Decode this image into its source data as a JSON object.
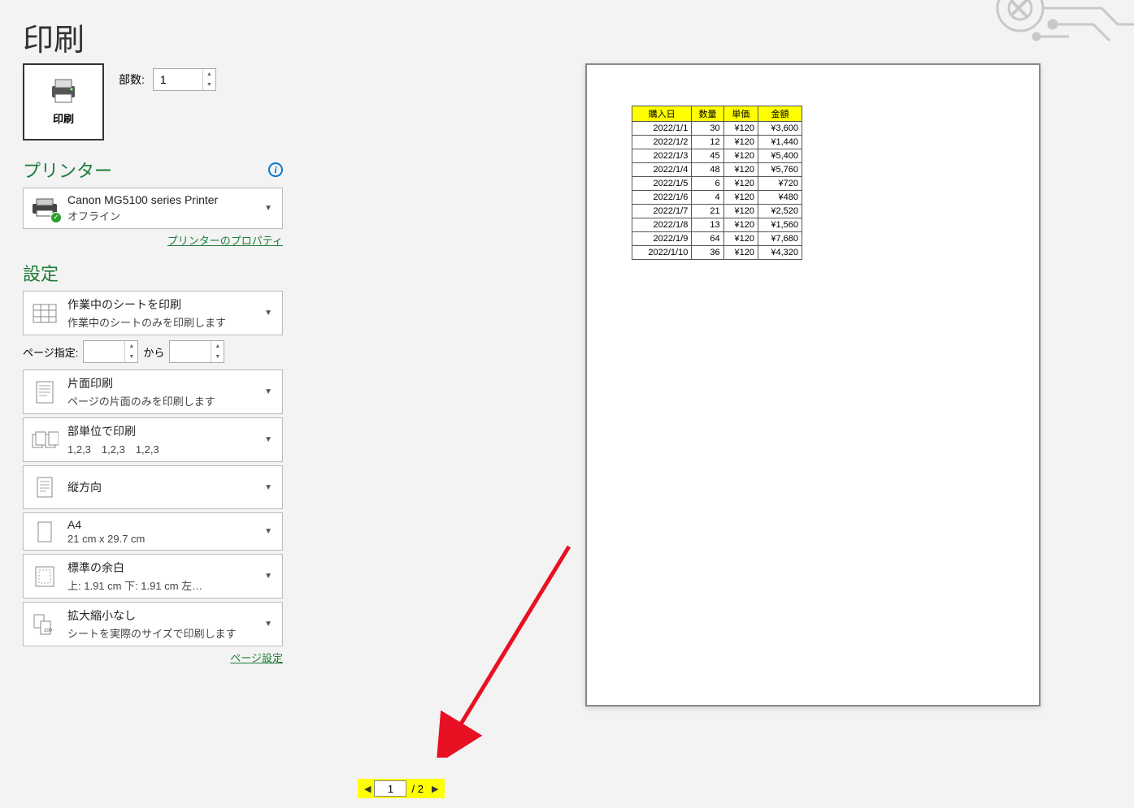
{
  "title": "印刷",
  "print_button_label": "印刷",
  "copies_label": "部数:",
  "copies_value": "1",
  "printer_heading": "プリンター",
  "printer": {
    "name": "Canon MG5100 series Printer",
    "status": "オフライン"
  },
  "printer_properties_link": "プリンターのプロパティ",
  "settings_heading": "設定",
  "settings": {
    "print_what": {
      "primary": "作業中のシートを印刷",
      "secondary": "作業中のシートのみを印刷します"
    },
    "page_range_label": "ページ指定:",
    "page_range_to": "から",
    "duplex": {
      "primary": "片面印刷",
      "secondary": "ページの片面のみを印刷します"
    },
    "collate": {
      "primary": "部単位で印刷",
      "secondary": "1,2,3　1,2,3　1,2,3"
    },
    "orientation": {
      "primary": "縦方向"
    },
    "paper": {
      "primary": "A4",
      "secondary": "21 cm x 29.7 cm"
    },
    "margins": {
      "primary": "標準の余白",
      "secondary": "上: 1.91 cm 下: 1.91 cm 左…"
    },
    "scaling": {
      "primary": "拡大縮小なし",
      "secondary": "シートを実際のサイズで印刷します"
    }
  },
  "page_setup_link": "ページ設定",
  "chart_data": {
    "type": "table",
    "headers": [
      "購入日",
      "数量",
      "単価",
      "金額"
    ],
    "rows": [
      [
        "2022/1/1",
        "30",
        "¥120",
        "¥3,600"
      ],
      [
        "2022/1/2",
        "12",
        "¥120",
        "¥1,440"
      ],
      [
        "2022/1/3",
        "45",
        "¥120",
        "¥5,400"
      ],
      [
        "2022/1/4",
        "48",
        "¥120",
        "¥5,760"
      ],
      [
        "2022/1/5",
        "6",
        "¥120",
        "¥720"
      ],
      [
        "2022/1/6",
        "4",
        "¥120",
        "¥480"
      ],
      [
        "2022/1/7",
        "21",
        "¥120",
        "¥2,520"
      ],
      [
        "2022/1/8",
        "13",
        "¥120",
        "¥1,560"
      ],
      [
        "2022/1/9",
        "64",
        "¥120",
        "¥7,680"
      ],
      [
        "2022/1/10",
        "36",
        "¥120",
        "¥4,320"
      ]
    ]
  },
  "page_nav": {
    "current": "1",
    "total": "/ 2"
  }
}
